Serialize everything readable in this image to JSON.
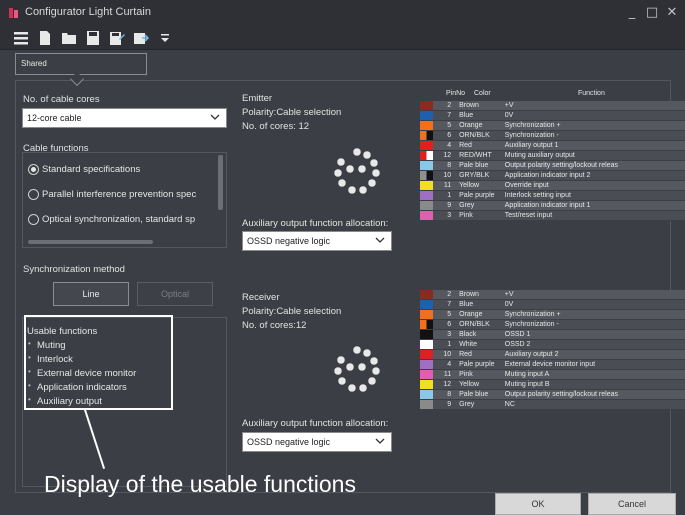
{
  "window": {
    "title": "Configurator Light Curtain"
  },
  "toolbar": {
    "icons": [
      "menu-icon",
      "new-file-icon",
      "open-folder-icon",
      "save-icon",
      "save-as-icon",
      "export-icon",
      "dropdown-icon"
    ]
  },
  "tab": {
    "label": "Shared"
  },
  "left": {
    "cable_cores_label": "No. of cable cores",
    "cable_cores_value": "12-core cable",
    "cable_functions_label": "Cable functions",
    "cable_functions": [
      {
        "label": "Standard specifications",
        "selected": true
      },
      {
        "label": "Parallel interference prevention spec",
        "selected": false
      },
      {
        "label": "Optical synchronization, standard sp",
        "selected": false
      }
    ],
    "sync_label": "Synchronization method",
    "sync_line": "Line",
    "sync_optical": "Optical",
    "usable_title": "Usable functions",
    "usable_items": [
      "Muting",
      "Interlock",
      "External device monitor",
      "Application indicators",
      "Auxiliary output"
    ]
  },
  "callout": {
    "text": "Display of the usable functions"
  },
  "emitter": {
    "title": "Emitter",
    "polarity": "Polarity:Cable selection",
    "cores": "No. of cores: 12",
    "aux_label": "Auxiliary output function allocation:",
    "aux_value": "OSSD negative logic"
  },
  "receiver": {
    "title": "Receiver",
    "polarity": "Polarity:Cable selection",
    "cores": "No. of cores:12",
    "aux_label": "Auxiliary output function allocation:",
    "aux_value": "OSSD negative logic"
  },
  "pin_headers": {
    "pin": "PinNo",
    "color": "Color",
    "function": "Function"
  },
  "emitter_pins": [
    {
      "pin": "2",
      "color": "Brown",
      "swatch": "#8b2a1e",
      "function": "+V"
    },
    {
      "pin": "7",
      "color": "Blue",
      "swatch": "#1f5fb0",
      "function": "0V"
    },
    {
      "pin": "5",
      "color": "Orange",
      "swatch": "#f07020",
      "function": "Synchronization +"
    },
    {
      "pin": "6",
      "color": "ORN/BLK",
      "swatch": "#f07020",
      "function": "Synchronization -"
    },
    {
      "pin": "4",
      "color": "Red",
      "swatch": "#e02020",
      "function": "Auxiliary output 1"
    },
    {
      "pin": "12",
      "color": "RED/WHT",
      "swatch": "#e02020",
      "function": "Muting auxiliary output"
    },
    {
      "pin": "8",
      "color": "Pale blue",
      "swatch": "#8ac8e8",
      "function": "Output polarity setting/lockout releas"
    },
    {
      "pin": "10",
      "color": "GRY/BLK",
      "swatch": "#909090",
      "function": "Application indicator input 2"
    },
    {
      "pin": "11",
      "color": "Yellow",
      "swatch": "#f0e020",
      "function": "Override input"
    },
    {
      "pin": "1",
      "color": "Pale purple",
      "swatch": "#a070c0",
      "function": "Interlock setting input"
    },
    {
      "pin": "9",
      "color": "Grey",
      "swatch": "#8a8a8a",
      "function": "Application indicator input 1"
    },
    {
      "pin": "3",
      "color": "Pink",
      "swatch": "#e060b0",
      "function": "Test/reset input"
    }
  ],
  "receiver_pins": [
    {
      "pin": "2",
      "color": "Brown",
      "swatch": "#8b2a1e",
      "function": "+V"
    },
    {
      "pin": "7",
      "color": "Blue",
      "swatch": "#1f5fb0",
      "function": "0V"
    },
    {
      "pin": "5",
      "color": "Orange",
      "swatch": "#f07020",
      "function": "Synchronization +"
    },
    {
      "pin": "6",
      "color": "ORN/BLK",
      "swatch": "#f07020",
      "function": "Synchronization -"
    },
    {
      "pin": "3",
      "color": "Black",
      "swatch": "#111111",
      "function": "OSSD 1"
    },
    {
      "pin": "1",
      "color": "White",
      "swatch": "#ffffff",
      "function": "OSSD 2"
    },
    {
      "pin": "10",
      "color": "Red",
      "swatch": "#e02020",
      "function": "Auxiliary output 2"
    },
    {
      "pin": "4",
      "color": "Pale purple",
      "swatch": "#a070c0",
      "function": "External device monitor input"
    },
    {
      "pin": "11",
      "color": "Pink",
      "swatch": "#e060b0",
      "function": "Muting input A"
    },
    {
      "pin": "12",
      "color": "Yellow",
      "swatch": "#f0e020",
      "function": "Muting input B"
    },
    {
      "pin": "8",
      "color": "Pale blue",
      "swatch": "#8ac8e8",
      "function": "Output polarity setting/lockout releas"
    },
    {
      "pin": "9",
      "color": "Grey",
      "swatch": "#8a8a8a",
      "function": "NC"
    }
  ],
  "footer": {
    "ok": "OK",
    "cancel": "Cancel"
  }
}
